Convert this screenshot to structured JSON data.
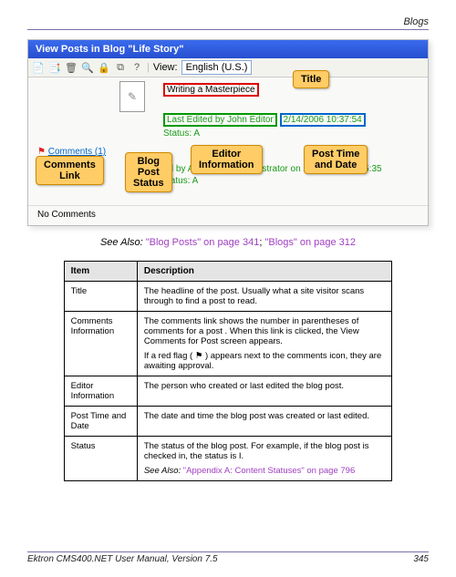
{
  "page": {
    "section_header": "Blogs",
    "footer_left": "Ektron CMS400.NET User Manual, Version 7.5",
    "footer_right": "345"
  },
  "figure": {
    "window_title": "View Posts in Blog \"Life Story\"",
    "view_label": "View:",
    "view_value": "English (U.S.)",
    "post_title": "Writing a Masterpiece",
    "last_edited": "Last Edited by John Editor ",
    "last_edited_date": "2/14/2006 10:37:54",
    "status_line": "Status: A",
    "comments_link": "Comments (1)",
    "created_by_line": "ed by Application Administrator on 2/14/2006 10:35:35",
    "status_line2": "status: A",
    "no_comments": "No Comments"
  },
  "callouts": {
    "title": "Title",
    "comments": "Comments\nLink",
    "blogpoststatus": "Blog\nPost\nStatus",
    "editorinfo": "Editor\nInformation",
    "posttime": "Post Time\nand Date"
  },
  "see_also": {
    "label": "See Also: ",
    "link1": "\"Blog Posts\" on page 341",
    "sep": "; ",
    "link2": "\"Blogs\" on page 312"
  },
  "table": {
    "head_item": "Item",
    "head_desc": "Description",
    "rows": [
      {
        "item": "Title",
        "desc": [
          "The headline of the post. Usually what a site visitor scans through to find a post to read."
        ]
      },
      {
        "item": "Comments Information",
        "desc": [
          "The comments link shows the number in parentheses of comments for a post . When this link is clicked, the View Comments for Post screen appears.",
          "If a red flag ( ⚑ ) appears next to the comments icon, they are awaiting approval."
        ]
      },
      {
        "item": "Editor Information",
        "desc": [
          "The person who created or last edited the blog post."
        ]
      },
      {
        "item": "Post Time and Date",
        "desc": [
          "The date and time the blog post was created or last edited."
        ]
      },
      {
        "item": "Status",
        "desc": [
          "The status of the blog post. For example, if the blog post is checked in, the status is I."
        ],
        "see_also": "See Also: ",
        "see_also_link": "\"Appendix A: Content Statuses\" on page 796"
      }
    ]
  }
}
